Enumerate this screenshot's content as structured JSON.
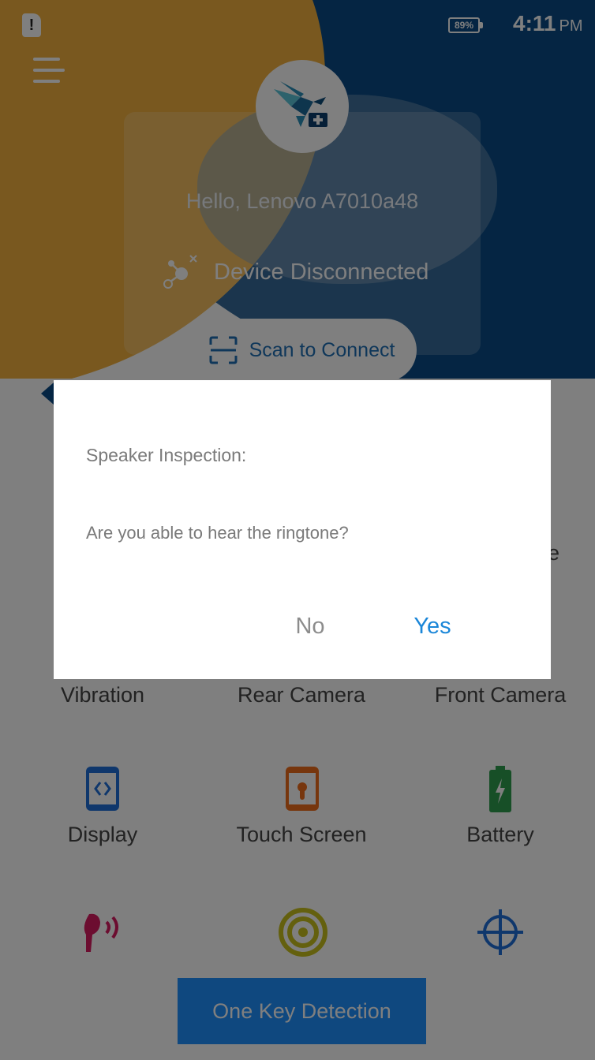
{
  "status_bar": {
    "battery": "89%",
    "time": "4:11",
    "ampm": "PM"
  },
  "header": {
    "greeting": "Hello, Lenovo A7010a48",
    "connection_status": "Device Disconnected",
    "scan_button": "Scan to Connect"
  },
  "tests": {
    "row1": [
      "Vibration",
      "Rear Camera",
      "Front Camera"
    ],
    "row2": [
      "Display",
      "Touch Screen",
      "Battery"
    ],
    "partial_label": "e"
  },
  "one_key_button": "One Key Detection",
  "dialog": {
    "title": "Speaker Inspection:",
    "message": "Are you able to hear the ringtone?",
    "no_label": "No",
    "yes_label": "Yes"
  },
  "colors": {
    "accent": "#1a86d8",
    "navy": "#0a4b86",
    "gold": "#f2b13e",
    "primary_button": "#1e90ff"
  }
}
